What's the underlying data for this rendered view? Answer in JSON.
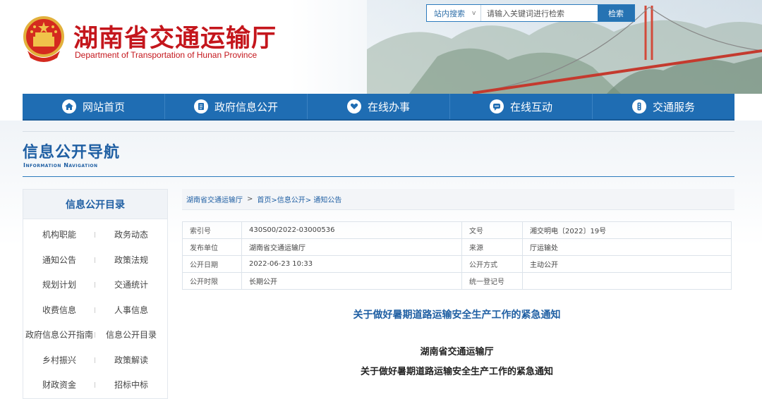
{
  "header": {
    "title": "湖南省交通运输厅",
    "subtitle": "Department of Transportation of Hunan Province"
  },
  "search": {
    "scope": "站内搜索",
    "placeholder": "请输入关键词进行检索",
    "button": "检索"
  },
  "nav": [
    {
      "label": "网站首页",
      "icon": "home-icon"
    },
    {
      "label": "政府信息公开",
      "icon": "document-icon"
    },
    {
      "label": "在线办事",
      "icon": "heart-hands-icon"
    },
    {
      "label": "在线互动",
      "icon": "chat-icon"
    },
    {
      "label": "交通服务",
      "icon": "traffic-light-icon"
    }
  ],
  "section": {
    "title": "信息公开导航",
    "subtitle": "Information Navigation"
  },
  "sidebar": {
    "title": "信息公开目录",
    "items": [
      "机构职能",
      "政务动态",
      "通知公告",
      "政策法规",
      "规划计划",
      "交通统计",
      "收费信息",
      "人事信息",
      "政府信息公开指南",
      "信息公开目录",
      "乡村振兴",
      "政策解读",
      "财政资金",
      "招标中标"
    ]
  },
  "breadcrumb": {
    "root": "湖南省交通运输厅",
    "sep": ">",
    "path": "首页>信息公开> 通知公告"
  },
  "meta": {
    "rows": [
      {
        "k1": "索引号",
        "v1": "430S00/2022-03000536",
        "k2": "文号",
        "v2": "湘交明电〔2022〕19号"
      },
      {
        "k1": "发布单位",
        "v1": "湖南省交通运输厅",
        "k2": "来源",
        "v2": "厅运输处"
      },
      {
        "k1": "公开日期",
        "v1": "2022-06-23 10:33",
        "k2": "公开方式",
        "v2": "主动公开"
      },
      {
        "k1": "公开时限",
        "v1": "长期公开",
        "k2": "统一登记号",
        "v2": ""
      }
    ]
  },
  "article": {
    "title": "关于做好暑期道路运输安全生产工作的紧急通知",
    "issuer": "湖南省交通运输厅",
    "heading": "关于做好暑期道路运输安全生产工作的紧急通知"
  },
  "colors": {
    "brand_red": "#c4161c",
    "nav_blue": "#1f6db3",
    "link_blue": "#1f5fa3"
  }
}
